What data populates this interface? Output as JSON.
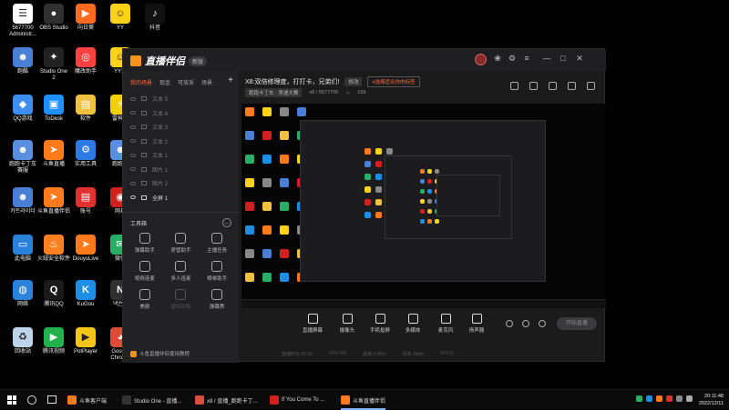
{
  "desktop": {
    "icons": [
      {
        "label": "5677700\nAdministr...",
        "color": "#ffffff",
        "glyph": "☰",
        "name": "admin-icon"
      },
      {
        "label": "OBS Studio",
        "color": "#303030",
        "glyph": "●",
        "name": "obs-icon"
      },
      {
        "label": "向日葵",
        "color": "#ff6a1f",
        "glyph": "▶",
        "name": "sunflower-icon"
      },
      {
        "label": "YY",
        "color": "#ffd21a",
        "glyph": "☺",
        "name": "yy-icon"
      },
      {
        "label": "抖音",
        "color": "#111111",
        "glyph": "♪",
        "name": "douyin-icon"
      },
      {
        "label": "跑酷",
        "color": "#4a7fd6",
        "glyph": "☻",
        "name": "parkour-icon"
      },
      {
        "label": "Studio One\n2",
        "color": "#222222",
        "glyph": "✦",
        "name": "studio-one-icon"
      },
      {
        "label": "魔改助手",
        "color": "#ff4040",
        "glyph": "◎",
        "name": "tool-icon"
      },
      {
        "label": "YY开",
        "color": "#ffd21a",
        "glyph": "☺",
        "name": "yy-open-icon"
      },
      {
        "label": "QQ游戏",
        "color": "#3d8ef0",
        "glyph": "◆",
        "name": "qqgame-icon"
      },
      {
        "label": "ToDesk",
        "color": "#1e90ff",
        "glyph": "▣",
        "name": "todesk-icon"
      },
      {
        "label": "软件",
        "color": "#f0c040",
        "glyph": "▤",
        "name": "folder-icon"
      },
      {
        "label": "雷神加",
        "color": "#f0d000",
        "glyph": "⚡",
        "name": "leishen-icon"
      },
      {
        "label": "跑跑卡丁车\n赛服",
        "color": "#5a8fe0",
        "glyph": "☻",
        "name": "kart-icon"
      },
      {
        "label": "斗鱼直播",
        "color": "#ff7a1a",
        "glyph": "➤",
        "name": "douyu-icon"
      },
      {
        "label": "实用工具",
        "color": "#2c7be5",
        "glyph": "⚙",
        "name": "utility-icon"
      },
      {
        "label": "跑跑卡",
        "color": "#5a8fe0",
        "glyph": "☻",
        "name": "kart2-icon"
      },
      {
        "label": "카트라이더",
        "color": "#4a7fd6",
        "glyph": "☻",
        "name": "kartrider-icon"
      },
      {
        "label": "斗鱼直播伴侣",
        "color": "#ff7a1a",
        "glyph": "➤",
        "name": "douyu-companion-icon"
      },
      {
        "label": "账号",
        "color": "#e03030",
        "glyph": "▤",
        "name": "account-icon"
      },
      {
        "label": "网易",
        "color": "#d02020",
        "glyph": "◉",
        "name": "netease-icon"
      },
      {
        "label": "此电脑",
        "color": "#2a82da",
        "glyph": "▭",
        "name": "this-pc-icon"
      },
      {
        "label": "火绒安全软件",
        "color": "#ff8020",
        "glyph": "♨",
        "name": "huorong-icon"
      },
      {
        "label": "DouyuLive",
        "color": "#ff7a1a",
        "glyph": "➤",
        "name": "douyulive-icon"
      },
      {
        "label": "微信",
        "color": "#2aae67",
        "glyph": "✉",
        "name": "wechat-icon"
      },
      {
        "label": "网络",
        "color": "#2a82da",
        "glyph": "◍",
        "name": "network-icon"
      },
      {
        "label": "腾讯QQ",
        "color": "#1a1a1a",
        "glyph": "Q",
        "name": "qq-icon"
      },
      {
        "label": "KuGou",
        "color": "#1c8ee6",
        "glyph": "K",
        "name": "kugou-icon"
      },
      {
        "label": "넥슨플",
        "color": "#303030",
        "glyph": "N",
        "name": "nexon-icon"
      },
      {
        "label": "回收站",
        "color": "#bcd4ea",
        "glyph": "♻",
        "name": "recycle-bin-icon"
      },
      {
        "label": "腾讯视频",
        "color": "#22b14c",
        "glyph": "▶",
        "name": "tencent-video-icon"
      },
      {
        "label": "PotPlayer",
        "color": "#f5c518",
        "glyph": "▶",
        "name": "potplayer-icon"
      },
      {
        "label": "Google\nChrome",
        "color": "#dd4b39",
        "glyph": "◕",
        "name": "chrome-icon"
      }
    ]
  },
  "app": {
    "name": "直播伴侣",
    "version": "新版",
    "room_title": "X8:双倍修理度，打打卡，兄弟们!",
    "edit_label": "修改",
    "room_tag": "#选择适合你的标签",
    "category": "跑跑卡丁车 · 竞速大赛",
    "room_id": "x8 / 5577700",
    "heat": "159",
    "tabs": [
      "我的场景",
      "现金",
      "可放采",
      "场景"
    ],
    "active_tab": "我的场景",
    "sources": [
      {
        "label": "文本 5",
        "on": false
      },
      {
        "label": "文本 4",
        "on": false
      },
      {
        "label": "文本 3",
        "on": false
      },
      {
        "label": "文本 2",
        "on": false
      },
      {
        "label": "文本 1",
        "on": false
      },
      {
        "label": "图片 1",
        "on": false
      },
      {
        "label": "图片 2",
        "on": false
      },
      {
        "label": "全屏 1",
        "on": true
      }
    ],
    "toolbox_label": "工具箱",
    "tools": [
      {
        "label": "弹幕助手",
        "dim": false
      },
      {
        "label": "房管助手",
        "dim": false
      },
      {
        "label": "主播任务",
        "dim": false
      },
      {
        "label": "视频连麦",
        "dim": false
      },
      {
        "label": "多人连麦",
        "dim": false
      },
      {
        "label": "榜单助手",
        "dim": false
      },
      {
        "label": "美颜",
        "dim": false
      },
      {
        "label": "虚拟形象",
        "dim": true
      },
      {
        "label": "弹幕秀",
        "dim": false
      }
    ],
    "tutorial_link": "斗鱼直播伴侣使用教程",
    "controls": [
      {
        "label": "直播屏幕"
      },
      {
        "label": "摄像头"
      },
      {
        "label": "手机投屏"
      },
      {
        "label": "多媒体"
      },
      {
        "label": "麦克风"
      },
      {
        "label": "扬声器"
      }
    ],
    "start_label": "开始直播",
    "status": [
      "直播时长 00:00",
      "CPU 0%",
      "丢帧 0.00%",
      "码率 0kb/s",
      "FPS 0"
    ]
  },
  "taskbar": {
    "items": [
      {
        "label": "斗鱼客户端",
        "color": "#ff7a1a",
        "active": false
      },
      {
        "label": "Studio One - 直播...",
        "color": "#333333",
        "active": false
      },
      {
        "label": "x8 / 直播_跑跑卡丁...",
        "color": "#dd4b39",
        "active": false
      },
      {
        "label": "If You Come To ...",
        "color": "#d02020",
        "active": false
      },
      {
        "label": "斗鱼直播伴侣",
        "color": "#ff7a1a",
        "active": true
      }
    ],
    "time": "20:11:48",
    "date": "2022/12/11"
  }
}
